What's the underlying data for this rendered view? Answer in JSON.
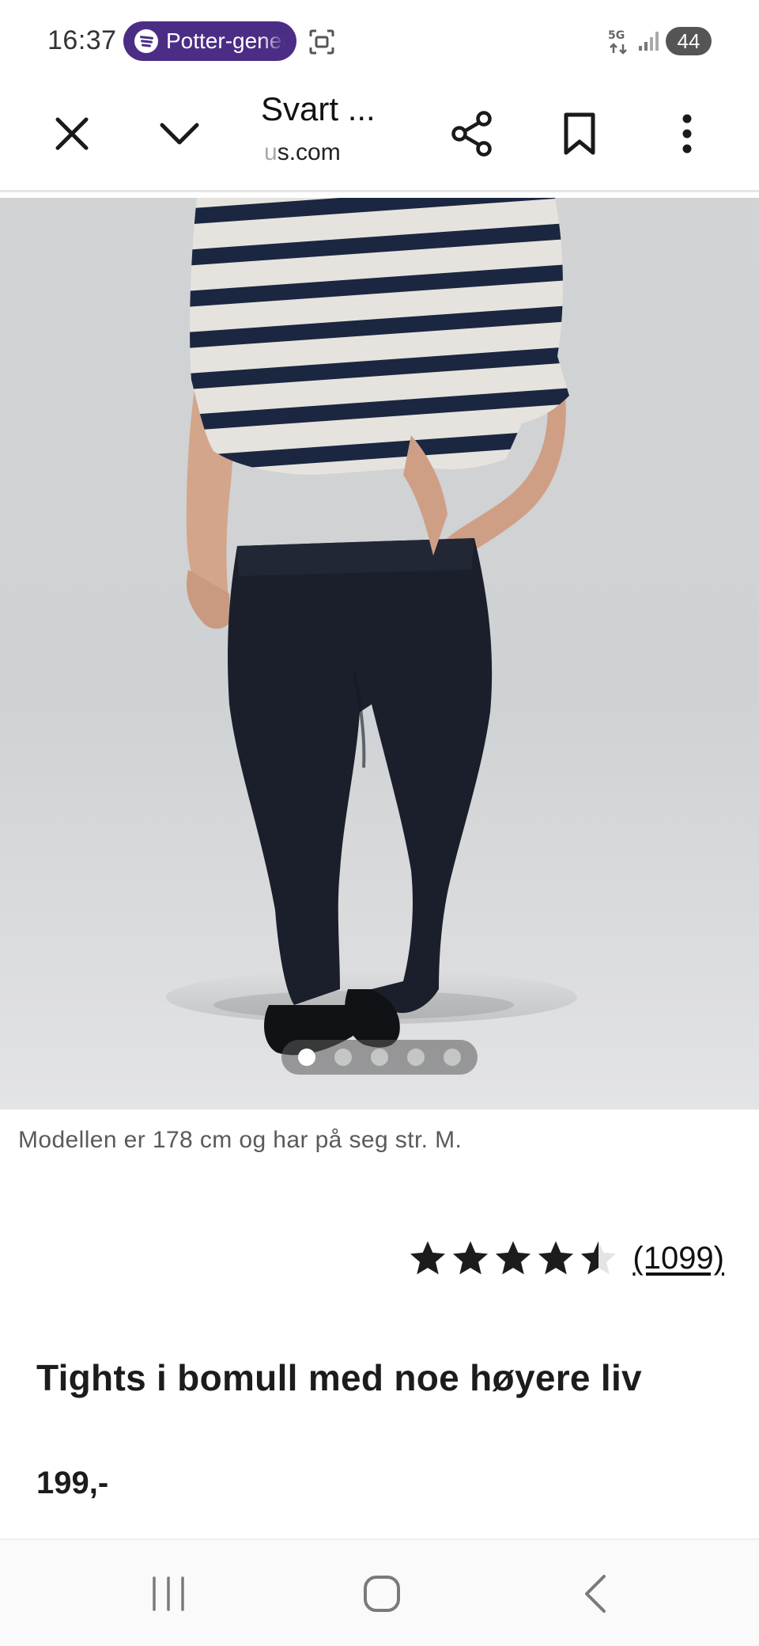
{
  "status_bar": {
    "time": "16:37",
    "media_pill": {
      "app_icon": "spotify-icon",
      "text": "Potter-generasjonen",
      "color": "#4b2d86"
    },
    "network_label": "5G",
    "battery": "44"
  },
  "browser": {
    "title": "Svart ...",
    "url_faded": "u",
    "url": "s.com",
    "icons": {
      "close": "close-icon",
      "collapse": "chevron-down-icon",
      "share": "share-icon",
      "bookmark": "bookmark-icon",
      "more": "more-vertical-icon"
    }
  },
  "gallery": {
    "image": "model-in-black-leggings-and-striped-sweater",
    "slide_count": 5,
    "active_slide": 1
  },
  "product": {
    "caption": "Modellen er 178 cm og har på seg str. M.",
    "rating": {
      "value": 4.5,
      "max": 5,
      "review_count": "(1099)"
    },
    "title": "Tights i bomull med noe høyere liv",
    "price": "199,-"
  },
  "nav_bar": {
    "icons": [
      "recent-apps-icon",
      "home-icon",
      "back-icon"
    ]
  }
}
